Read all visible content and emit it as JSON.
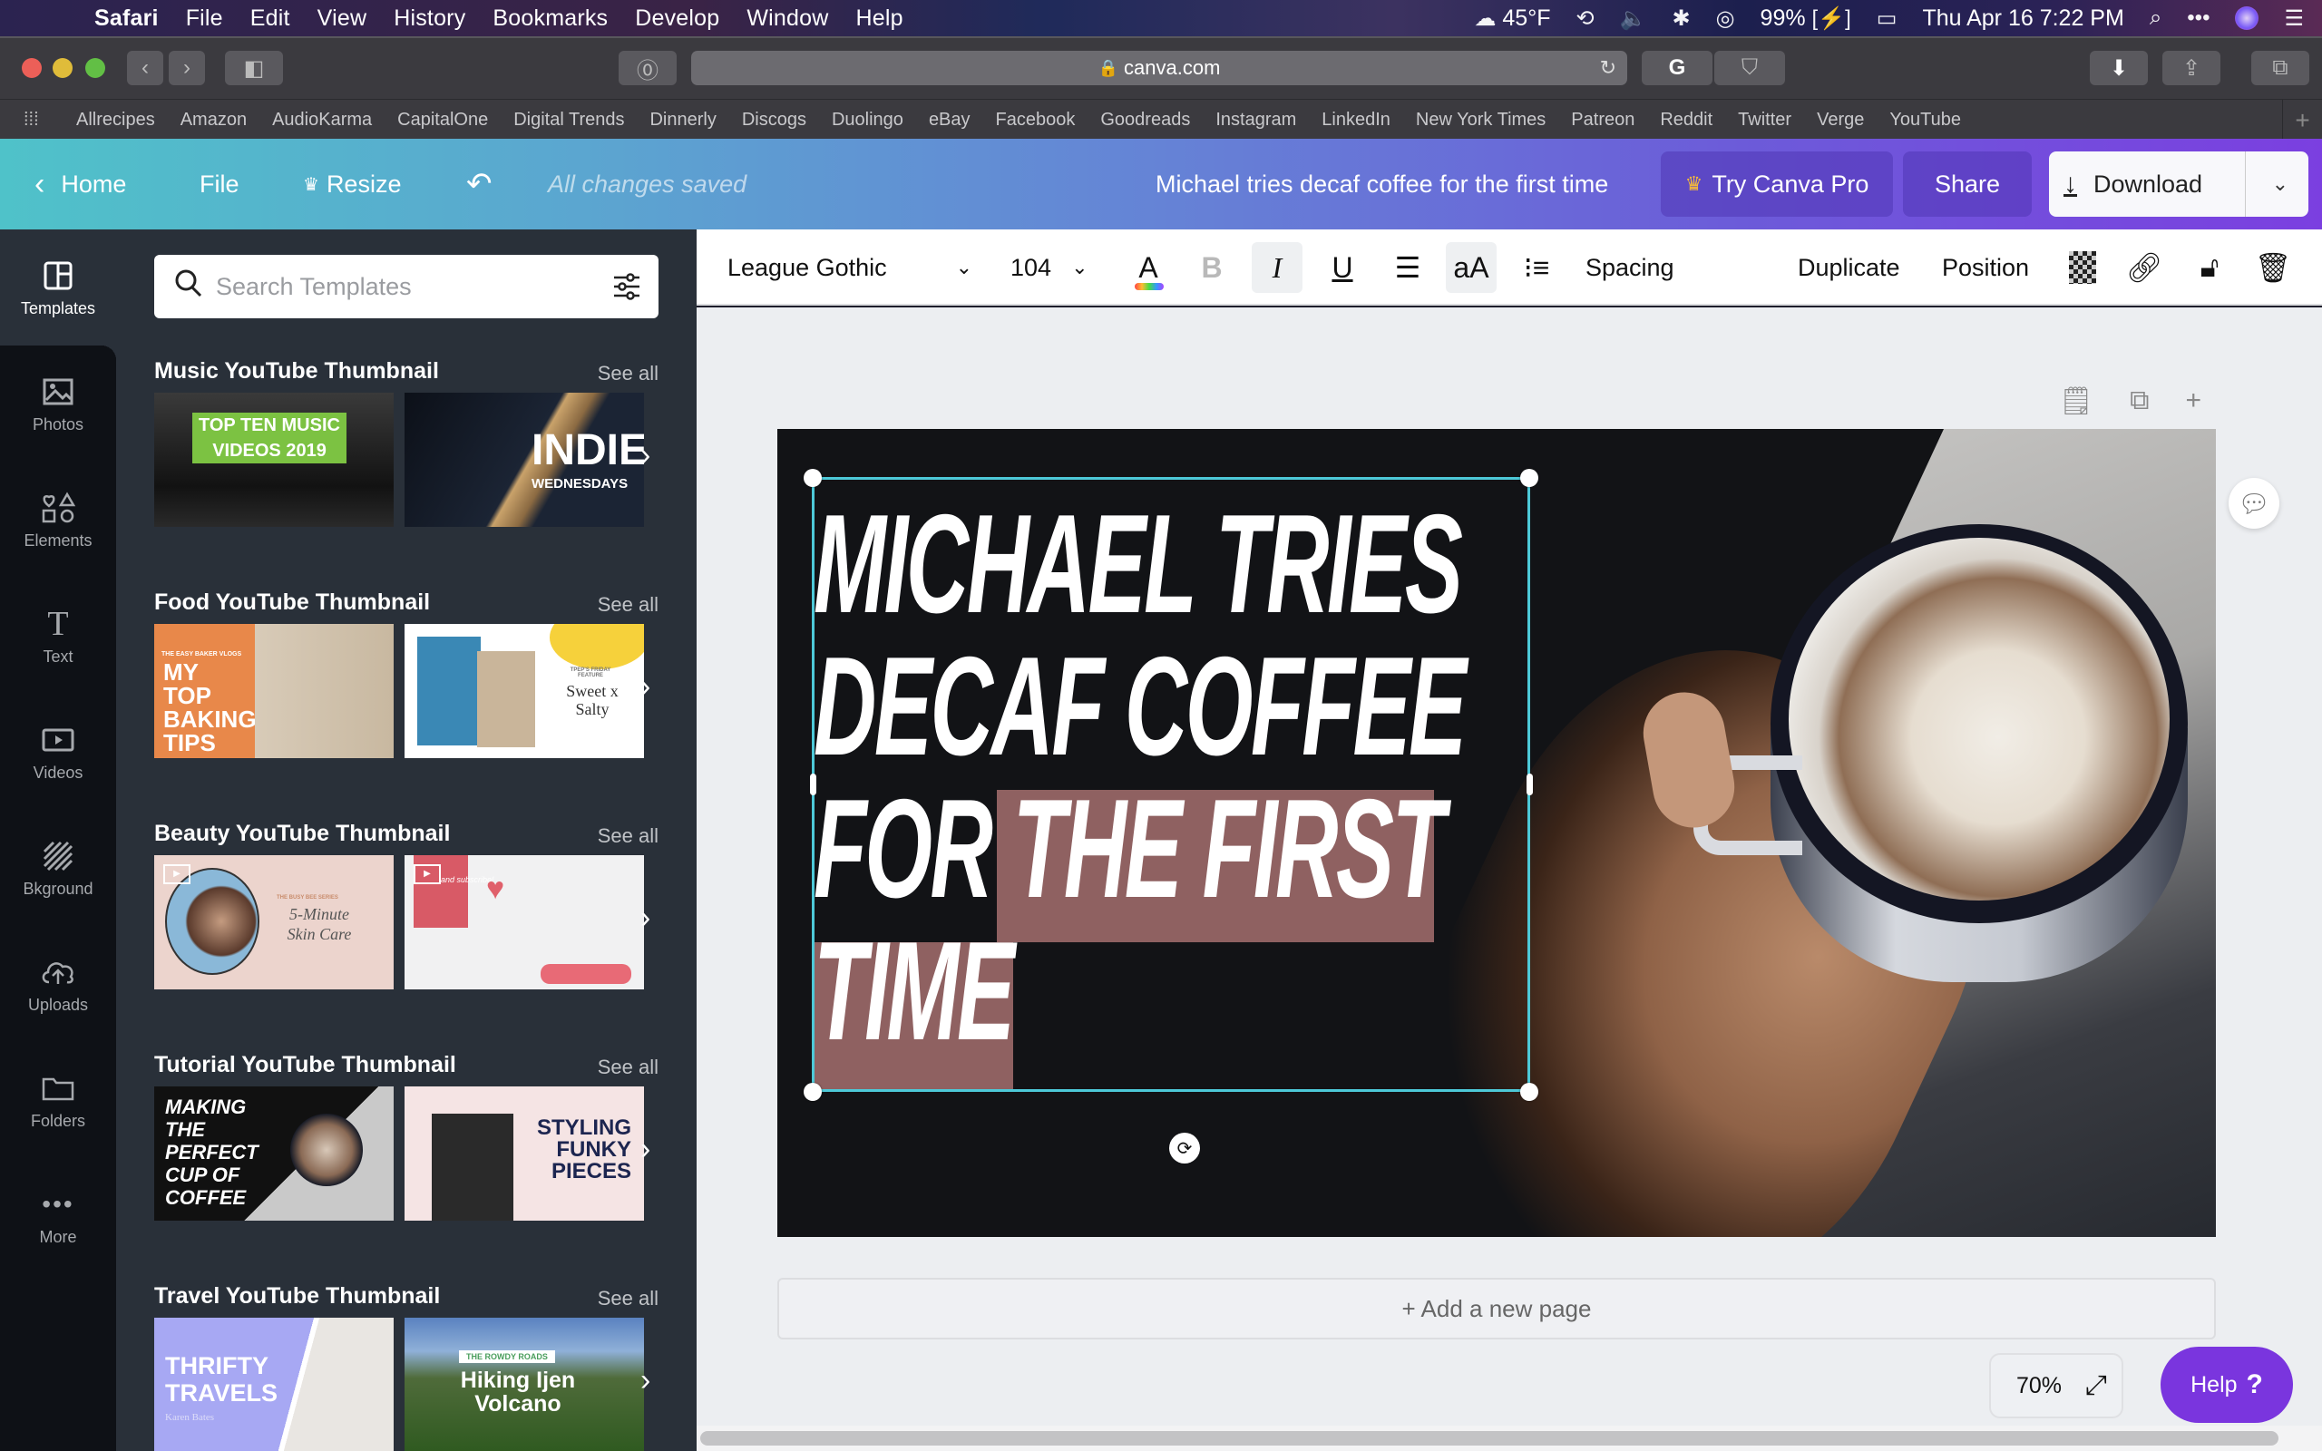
{
  "menubar": {
    "app": "Safari",
    "items": [
      "File",
      "Edit",
      "View",
      "History",
      "Bookmarks",
      "Develop",
      "Window",
      "Help"
    ],
    "status": {
      "weather": "45°F",
      "battery": "99%",
      "datetime": "Thu Apr 16  7:22 PM"
    }
  },
  "browser": {
    "url": "canva.com",
    "bookmarks": [
      "Allrecipes",
      "Amazon",
      "AudioKarma",
      "CapitalOne",
      "Digital Trends",
      "Dinnerly",
      "Discogs",
      "Duolingo",
      "eBay",
      "Facebook",
      "Goodreads",
      "Instagram",
      "LinkedIn",
      "New York Times",
      "Patreon",
      "Reddit",
      "Twitter",
      "Verge",
      "YouTube"
    ]
  },
  "header": {
    "home": "Home",
    "file": "File",
    "resize": "Resize",
    "status": "All changes saved",
    "doc_title": "Michael tries decaf coffee for the first time",
    "try_pro": "Try Canva Pro",
    "share": "Share",
    "download": "Download"
  },
  "rail": {
    "items": [
      {
        "label": "Templates",
        "icon": "templates-icon"
      },
      {
        "label": "Photos",
        "icon": "photos-icon"
      },
      {
        "label": "Elements",
        "icon": "elements-icon"
      },
      {
        "label": "Text",
        "icon": "text-icon"
      },
      {
        "label": "Videos",
        "icon": "videos-icon"
      },
      {
        "label": "Bkground",
        "icon": "background-icon"
      },
      {
        "label": "Uploads",
        "icon": "uploads-icon"
      },
      {
        "label": "Folders",
        "icon": "folders-icon"
      },
      {
        "label": "More",
        "icon": "more-icon"
      }
    ]
  },
  "panel": {
    "search_placeholder": "Search Templates",
    "see_all": "See all",
    "sections": [
      {
        "title": "Music YouTube Thumbnail",
        "thumbs": [
          {
            "text": "TOP TEN MUSIC VIDEOS 2019"
          },
          {
            "text": "INDIE",
            "sub": "WEDNESDAYS"
          }
        ]
      },
      {
        "title": "Food YouTube Thumbnail",
        "thumbs": [
          {
            "text": "MY TOP BAKING TIPS",
            "sub": "THE EASY BAKER VLOGS"
          },
          {
            "text": "Sweet x Salty",
            "sub": "TPEP'S FRIDAY FEATURE"
          }
        ]
      },
      {
        "title": "Beauty YouTube Thumbnail",
        "thumbs": [
          {
            "text": "5-Minute Skin Care",
            "sub": "THE BUSY BEE SERIES"
          },
          {
            "text": "and subscribe!"
          }
        ]
      },
      {
        "title": "Tutorial YouTube Thumbnail",
        "thumbs": [
          {
            "text": "MAKING THE PERFECT CUP OF COFFEE"
          },
          {
            "text": "STYLING FUNKY PIECES"
          }
        ]
      },
      {
        "title": "Travel YouTube Thumbnail",
        "thumbs": [
          {
            "text": "THRIFTY TRAVELS",
            "sub": "Karen Bates"
          },
          {
            "text": "Hiking Ijen Volcano",
            "sub": "THE ROWDY ROADS"
          }
        ]
      }
    ]
  },
  "toolbar": {
    "font": "League Gothic",
    "size": "104",
    "bold": "B",
    "italic": "I",
    "underline": "U",
    "case": "aA",
    "spacing": "Spacing",
    "duplicate": "Duplicate",
    "position": "Position"
  },
  "design": {
    "headline_lines": [
      "MICHAEL TRIES",
      "DECAF COFFEE",
      "FOR THE FIRST",
      "TIME"
    ],
    "highlight_color": "#a06c6c",
    "selection_color": "#4dc9d8"
  },
  "workspace": {
    "add_page": "+ Add a new page",
    "zoom": "70%",
    "help": "Help",
    "help_glyph": "?"
  },
  "colors": {
    "canva_purple": "#7a35de",
    "canva_teal": "#4fc2c9",
    "panel_bg": "#293039",
    "rail_bg": "#0e1116"
  }
}
